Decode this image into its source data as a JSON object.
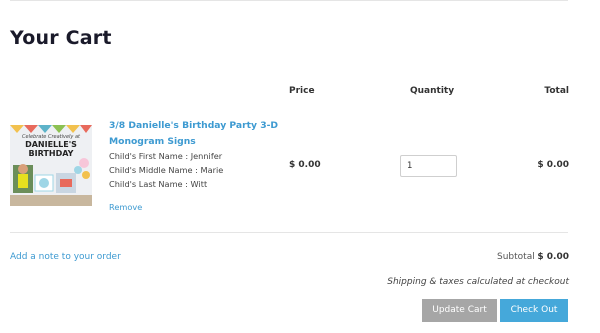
{
  "page": {
    "title": "Your Cart"
  },
  "table_headers": {
    "price": "Price",
    "quantity": "Quantity",
    "total": "Total"
  },
  "item": {
    "name": "3/8 Danielle's Birthday Party 3-D Monogram Signs",
    "image_text": {
      "line1": "Celebrate Creatively at",
      "line2": "DANIELLE'S",
      "line3": "BIRTHDAY"
    },
    "properties": [
      "Child's First Name : Jennifer",
      "Child's Middle Name : Marie",
      "Child's Last Name : Witt"
    ],
    "remove_label": "Remove",
    "price": "$ 0.00",
    "quantity": "1",
    "total": "$ 0.00"
  },
  "footer": {
    "note_link": "Add a note to your order",
    "subtotal_label": "Subtotal",
    "subtotal_value": "$ 0.00",
    "shipping_note": "Shipping & taxes calculated at checkout",
    "update_button": "Update Cart",
    "checkout_button": "Check Out"
  },
  "colors": {
    "link": "#3d9ad1",
    "update_button": "#a6a6a6",
    "checkout_button": "#45a8da",
    "title": "#1a1a2a"
  }
}
